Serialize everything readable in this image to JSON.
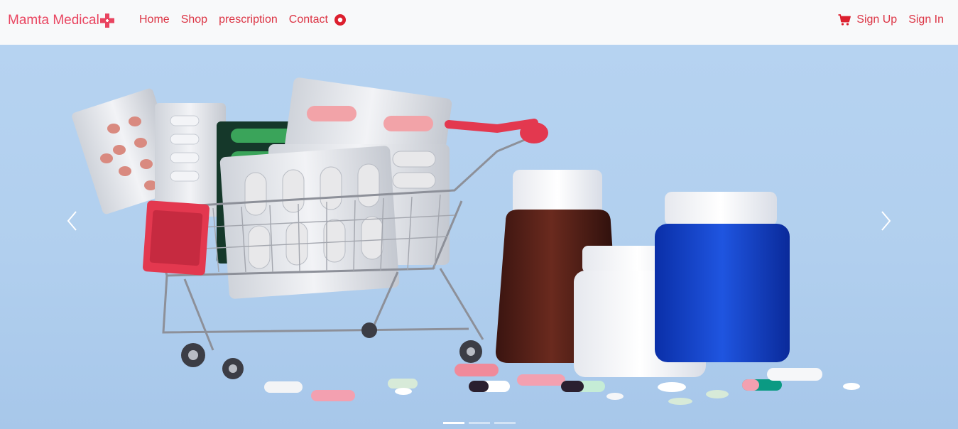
{
  "brand": {
    "name": "Mamta Medical",
    "icon": "medical-cross-icon",
    "color": "#e94560"
  },
  "nav": {
    "links": [
      {
        "label": "Home"
      },
      {
        "label": "Shop"
      },
      {
        "label": "prescription"
      },
      {
        "label": "Contact"
      }
    ],
    "contact_icon": "record-circle-icon",
    "right": {
      "cart_icon": "cart-icon",
      "signup_label": "Sign Up",
      "signin_label": "Sign In"
    },
    "link_color": "#dc3545"
  },
  "carousel": {
    "active_slide": 1,
    "slide_count": 3,
    "slide_image": "pharmacy-shopping-cart-pills-bottles",
    "prev_icon": "chevron-left-icon",
    "next_icon": "chevron-right-icon"
  }
}
